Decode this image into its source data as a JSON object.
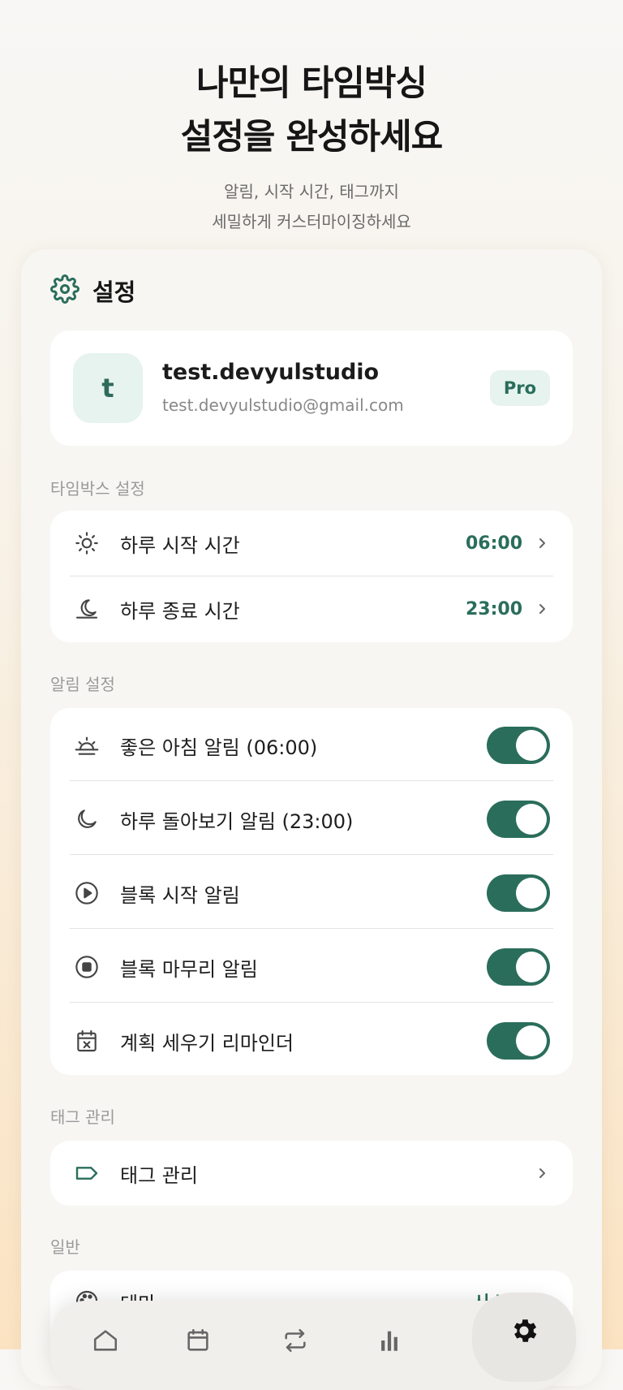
{
  "hero": {
    "title_line1": "나만의 타임박싱",
    "title_line2": "설정을 완성하세요",
    "subtitle_line1": "알림, 시작 시간, 태그까지",
    "subtitle_line2": "세밀하게 커스터마이징하세요"
  },
  "header": {
    "title": "설정",
    "icon": "gear-icon"
  },
  "profile": {
    "avatar_letter": "t",
    "name": "test.devyulstudio",
    "email": "test.devyulstudio@gmail.com",
    "badge": "Pro"
  },
  "timebox": {
    "section_label": "타임박스 설정",
    "items": [
      {
        "label": "하루 시작 시간",
        "value": "06:00",
        "icon": "sun-icon"
      },
      {
        "label": "하루 종료 시간",
        "value": "23:00",
        "icon": "moon-icon"
      }
    ]
  },
  "alarms": {
    "section_label": "알림 설정",
    "items": [
      {
        "label": "좋은 아침 알림 (06:00)",
        "icon": "sunrise-icon",
        "on": true
      },
      {
        "label": "하루 돌아보기 알림 (23:00)",
        "icon": "moon-icon",
        "on": true
      },
      {
        "label": "블록 시작 알림",
        "icon": "play-circle-icon",
        "on": true
      },
      {
        "label": "블록 마무리 알림",
        "icon": "stop-circle-icon",
        "on": true
      },
      {
        "label": "계획 세우기 리마인더",
        "icon": "calendar-x-icon",
        "on": true
      }
    ]
  },
  "tags": {
    "section_label": "태그 관리",
    "item_label": "태그 관리",
    "icon": "tag-icon"
  },
  "general": {
    "section_label": "일반",
    "items": [
      {
        "label": "테마",
        "value": "시스템",
        "icon": "palette-icon"
      }
    ]
  },
  "tabbar": {
    "tabs": [
      "home-icon",
      "calendar-icon",
      "repeat-icon",
      "stats-icon",
      "gear-icon"
    ],
    "active": "gear-icon"
  },
  "colors": {
    "accent": "#2a6d5b",
    "accent_light": "#e6f3ee",
    "card_bg": "#f7f6f3"
  }
}
